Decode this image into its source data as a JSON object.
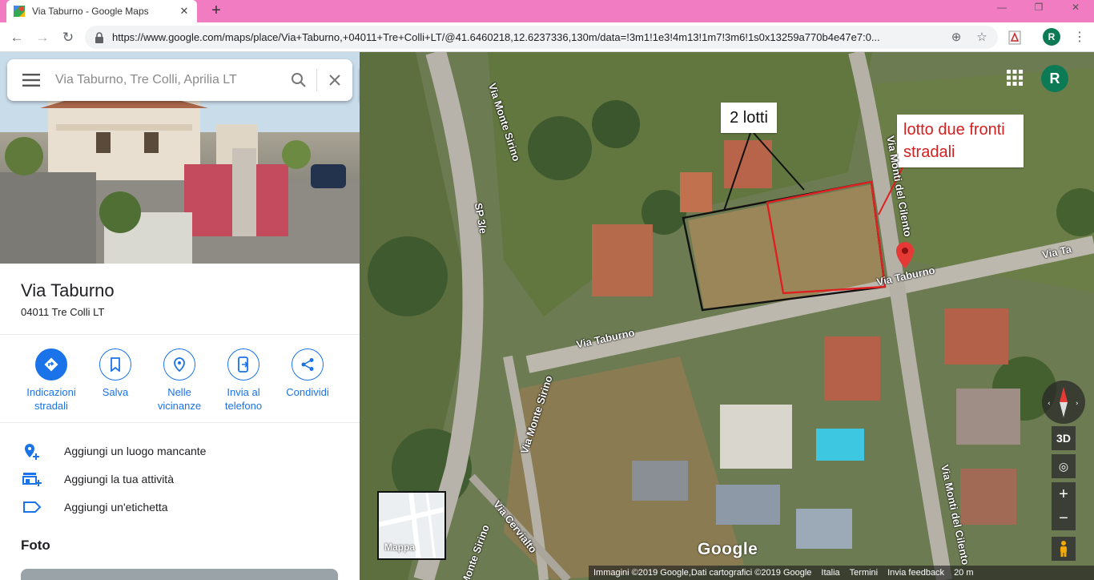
{
  "browser": {
    "tab_title": "Via Taburno - Google Maps",
    "new_tab_label": "+",
    "url": "https://www.google.com/maps/place/Via+Taburno,+04011+Tre+Colli+LT/@41.6460218,12.6237336,130m/data=!3m1!1e3!4m13!1m7!3m6!1s0x13259a770b4e47e7:0...",
    "avatar_letter": "R",
    "window_controls": [
      "—",
      "❐",
      "✕"
    ]
  },
  "search": {
    "placeholder": "Via Taburno, Tre Colli, Aprilia LT"
  },
  "place": {
    "title": "Via Taburno",
    "subtitle": "04011 Tre Colli LT"
  },
  "actions": [
    {
      "label": "Indicazioni stradali",
      "icon": "directions-icon"
    },
    {
      "label": "Salva",
      "icon": "bookmark-icon"
    },
    {
      "label": "Nelle vicinanze",
      "icon": "nearby-icon"
    },
    {
      "label": "Invia al telefono",
      "icon": "send-to-phone-icon"
    },
    {
      "label": "Condividi",
      "icon": "share-icon"
    }
  ],
  "add_items": [
    {
      "label": "Aggiungi un luogo mancante",
      "icon": "add-place-icon"
    },
    {
      "label": "Aggiungi la tua attività",
      "icon": "add-business-icon"
    },
    {
      "label": "Aggiungi un'etichetta",
      "icon": "label-icon"
    }
  ],
  "foto_title": "Foto",
  "map": {
    "annotation_left": "2 lotti",
    "annotation_right": "lotto due fronti stradali",
    "street_labels": [
      "Via Monte Sirino",
      "SP 3/e",
      "Via Taburno",
      "Via Taburno",
      "Via Monti del Cilento",
      "Via Monte Sirino",
      "Via Cervialto",
      "Monte Sirino",
      "Via Monti del Cilento",
      "Via Ta"
    ],
    "avatar_letter": "R",
    "btn_3d": "3D",
    "zoom_in": "+",
    "zoom_out": "−",
    "minimap_label": "Mappa",
    "google_logo": "Google",
    "footer": [
      "Immagini ©2019 Google,Dati cartografici ©2019 Google",
      "Italia",
      "Termini",
      "Invia feedback",
      "20 m"
    ],
    "accent_red": "#d32020",
    "pin_color": "#e53935"
  }
}
